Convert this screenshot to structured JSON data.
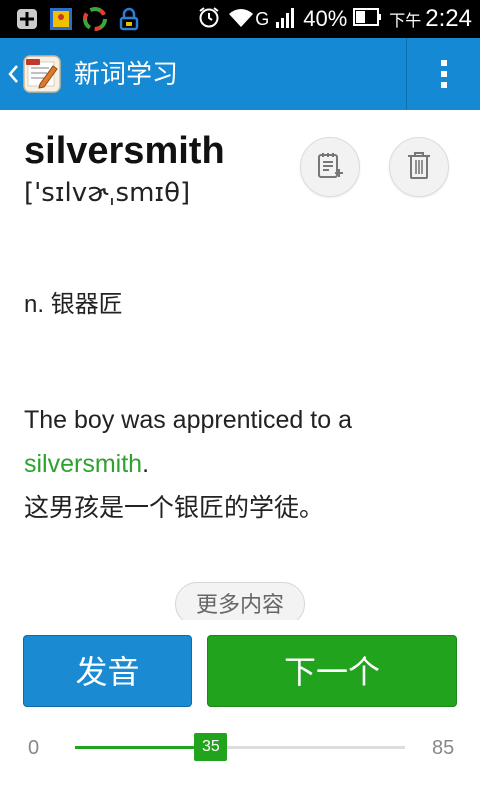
{
  "status_bar": {
    "battery_percent": "40%",
    "time_prefix": "下午",
    "time": "2:24",
    "network_label": "G",
    "icons": [
      "add-icon",
      "photo-icon",
      "sync-icon",
      "lock-icon",
      "alarm-icon",
      "wifi-icon",
      "signal-icon",
      "battery-icon"
    ]
  },
  "action_bar": {
    "title": "新词学习",
    "background": "#1589d3"
  },
  "word": {
    "text": "silversmith",
    "phonetic": "['sɪlvɚˌsmɪθ]"
  },
  "definition": "n. 银器匠",
  "example": {
    "before": "The boy was apprenticed to a ",
    "highlight": "silversmith",
    "after": ".",
    "translation": "这男孩是一个银匠的学徒。",
    "highlight_color": "#2ea12e"
  },
  "buttons": {
    "more": "更多内容",
    "speak": "发音",
    "next": "下一个"
  },
  "progress": {
    "min": "0",
    "max": "85",
    "current": "35",
    "current_value": 35,
    "min_value": 0,
    "max_value": 85
  }
}
